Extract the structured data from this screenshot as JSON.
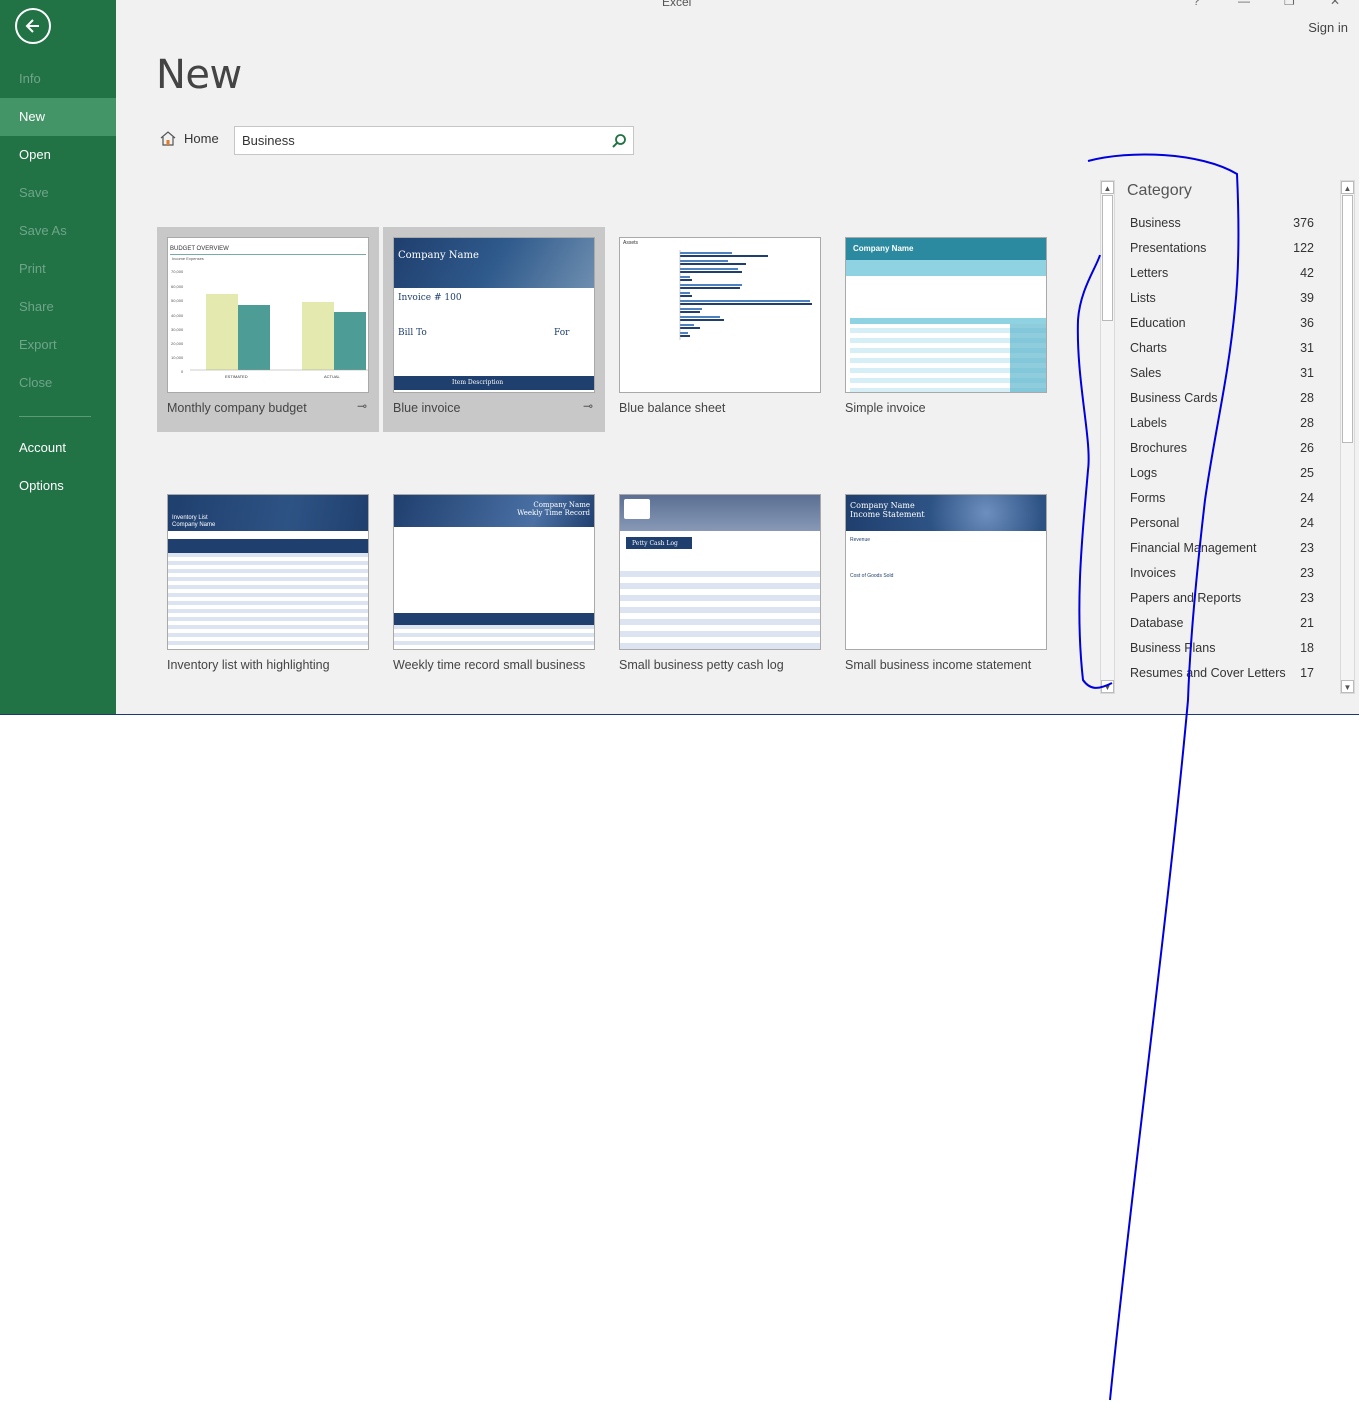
{
  "window": {
    "title": "Excel",
    "sign_in": "Sign in"
  },
  "sidebar": {
    "items": [
      {
        "label": "Info",
        "enabled": false
      },
      {
        "label": "New",
        "enabled": true,
        "active": true
      },
      {
        "label": "Open",
        "enabled": true
      },
      {
        "label": "Save",
        "enabled": false
      },
      {
        "label": "Save As",
        "enabled": false
      },
      {
        "label": "Print",
        "enabled": false
      },
      {
        "label": "Share",
        "enabled": false
      },
      {
        "label": "Export",
        "enabled": false
      },
      {
        "label": "Close",
        "enabled": false
      }
    ],
    "bottom_items": [
      {
        "label": "Account"
      },
      {
        "label": "Options"
      }
    ]
  },
  "main": {
    "title": "New",
    "home_label": "Home",
    "search": {
      "value": "Business"
    }
  },
  "templates": [
    {
      "name": "Monthly company budget",
      "selected": true,
      "pinned": true
    },
    {
      "name": "Blue invoice",
      "selected": true,
      "pinned": true
    },
    {
      "name": "Blue balance sheet",
      "selected": false,
      "pinned": false
    },
    {
      "name": "Simple invoice",
      "selected": false,
      "pinned": false
    },
    {
      "name": "Inventory list with highlighting",
      "selected": false,
      "pinned": false
    },
    {
      "name": "Weekly time record small business",
      "selected": false,
      "pinned": false
    },
    {
      "name": "Small business petty cash log",
      "selected": false,
      "pinned": false
    },
    {
      "name": "Small business income statement",
      "selected": false,
      "pinned": false
    }
  ],
  "thumb_text": {
    "budget_title": "BUDGET OVERVIEW",
    "budget_legend": "Income  Expenses",
    "budget_ticks": [
      "70,000",
      "60,000",
      "50,000",
      "40,000",
      "30,000",
      "20,000",
      "10,000",
      "0"
    ],
    "budget_cats": [
      "ESTIMATED",
      "ACTUAL"
    ],
    "company_name": "Company Name",
    "invoice_no": "Invoice # 100",
    "bill_to": "Bill To",
    "for": "For",
    "item_description": "Item Description",
    "assets": "Assets",
    "inventory_list": "Inventory List",
    "weekly_time_record": "Weekly Time Record",
    "petty_cash_log": "Petty Cash Log",
    "income_statement": "Income Statement",
    "revenue": "Revenue",
    "cost_of_goods_sold": "Cost of Goods Sold"
  },
  "category": {
    "heading": "Category",
    "items": [
      {
        "label": "Business",
        "count": "376"
      },
      {
        "label": "Presentations",
        "count": "122"
      },
      {
        "label": "Letters",
        "count": "42"
      },
      {
        "label": "Lists",
        "count": "39"
      },
      {
        "label": "Education",
        "count": "36"
      },
      {
        "label": "Charts",
        "count": "31"
      },
      {
        "label": "Sales",
        "count": "31"
      },
      {
        "label": "Business Cards",
        "count": "28"
      },
      {
        "label": "Labels",
        "count": "28"
      },
      {
        "label": "Brochures",
        "count": "26"
      },
      {
        "label": "Logs",
        "count": "25"
      },
      {
        "label": "Forms",
        "count": "24"
      },
      {
        "label": "Personal",
        "count": "24"
      },
      {
        "label": "Financial Management",
        "count": "23"
      },
      {
        "label": "Invoices",
        "count": "23"
      },
      {
        "label": "Papers and Reports",
        "count": "23"
      },
      {
        "label": "Database",
        "count": "21"
      },
      {
        "label": "Business Plans",
        "count": "18"
      },
      {
        "label": "Resumes and Cover Letters",
        "count": "17"
      }
    ]
  },
  "colors": {
    "sidebar_bg": "#217346",
    "sidebar_active": "#439467",
    "annotation_ink": "#0000dd"
  }
}
